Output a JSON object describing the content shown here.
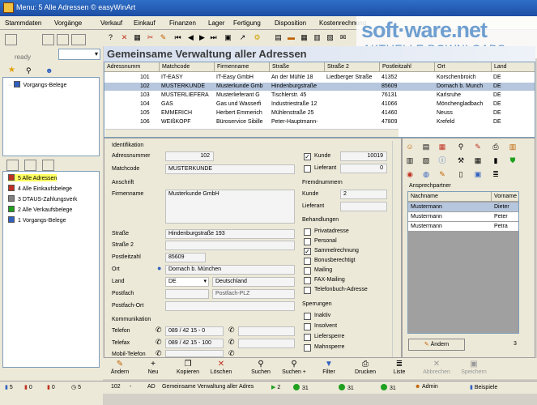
{
  "window": {
    "title": "Menu: 5  Alle Adressen  © easyWinArt"
  },
  "menu": [
    "Stammdaten",
    "Vorgänge",
    "Verkauf",
    "Einkauf",
    "Finanzen",
    "Lager",
    "Fertigung",
    "Disposition",
    "Kostenrechnung",
    "OEM",
    "Fenster"
  ],
  "watermark": {
    "line1": "soft·ware.net",
    "line2": "AKTUELLE DOWNLOADS"
  },
  "left": {
    "status": "ready",
    "tree_top": [
      "Vorgangs-Belege"
    ],
    "tree_bottom": [
      {
        "label": "5  Alle Adressen",
        "color": "#c03020"
      },
      {
        "label": "4  Alle Einkaufsbelege",
        "color": "#c03020"
      },
      {
        "label": "3  DTAUS-Zahlungsverk",
        "color": "#808080"
      },
      {
        "label": "2  Alle Verkaufsbelege",
        "color": "#20a020"
      },
      {
        "label": "1  Vorgangs-Belege",
        "color": "#3060c0"
      }
    ]
  },
  "page_title": "Gemeinsame Verwaltung aller Adressen",
  "grid": {
    "columns": [
      "Adressnumm",
      "Matchcode",
      "Firmenname",
      "Straße",
      "Straße 2",
      "Postleitzahl",
      "Ort",
      "Land"
    ],
    "rows": [
      [
        "101",
        "IT-EASY",
        "IT-Easy GmbH",
        "An der Mühle 18",
        "Liedberger Straße",
        "41352",
        "Korschenbroich",
        "DE"
      ],
      [
        "102",
        "MUSTERKUNDE",
        "Musterkunde Gmb",
        "Hindenburgstraße",
        "",
        "85609",
        "Dornach b. Munch",
        "DE"
      ],
      [
        "103",
        "MUSTERLIEFERA",
        "Musterlieferant G",
        "Tischlerstr. 45",
        "",
        "76131",
        "Karlsruhe",
        "DE"
      ],
      [
        "104",
        "GAS",
        "Gas und Wasserfi",
        "Industriestraße 12",
        "",
        "41066",
        "Mönchengladbach",
        "DE"
      ],
      [
        "105",
        "EMMERICH",
        "Herbert Emmerich",
        "Mühlenstraße 25",
        "",
        "41460",
        "Neuss",
        "DE"
      ],
      [
        "106",
        "WEIßKOPF",
        "Büroservice Sibille",
        "Peter-Hauptmann-",
        "",
        "47809",
        "Krefeld",
        "DE"
      ]
    ]
  },
  "form": {
    "identifikation": "Identifikation",
    "adressnummer_label": "Adressnummer",
    "adressnummer": "102",
    "matchcode_label": "Matchcode",
    "matchcode": "MUSTERKUNDE",
    "anschrift": "Anschrift",
    "firmenname_label": "Firmenname",
    "firmenname": "Musterkunde GmbH",
    "strasse_label": "Straße",
    "strasse": "Hindenburgstraße 193",
    "strasse2_label": "Straße 2",
    "plz_label": "Postleitzahl",
    "plz": "85609",
    "ort_label": "Ort",
    "ort": "Dornach b. München",
    "land_label": "Land",
    "land": "DE",
    "land_name": "Deutschland",
    "postfach_label": "Postfach",
    "postfach_plz": "Postfach-PLZ",
    "postfach_ort_label": "Postfach-Ort",
    "kommunikation": "Kommunikation",
    "telefon_label": "Telefon",
    "telefon": "089 / 42 15 - 0",
    "telefax_label": "Telefax",
    "telefax": "089 / 42 15 - 100",
    "mobil_label": "Mobil-Telefon",
    "kunde_label": "Kunde",
    "kunde_nr": "10019",
    "lieferant_label": "Lieferant",
    "lieferant_nr": "0",
    "fremdnummern": "Fremdnummern",
    "fn_kunde_label": "Kunde",
    "fn_kunde": "2",
    "fn_lieferant_label": "Lieferant",
    "behandlungen": "Behandlungen",
    "beh_items": [
      "Privatadresse",
      "Personal",
      "Sammelrechnung",
      "Bonusberechtigt",
      "Mailing",
      "FAX-Mailing",
      "Telefonbuch-Adresse"
    ],
    "beh_checked": [
      false,
      false,
      true,
      false,
      false,
      false,
      false
    ],
    "sperrungen": "Sperrungen",
    "sperr_items": [
      "Inaktiv",
      "Insolvent",
      "Liefersperre",
      "Mahnsperre"
    ]
  },
  "contacts": {
    "title": "Ansprechpartner",
    "columns": [
      "Nachname",
      "Vorname"
    ],
    "rows": [
      [
        "Mustermann",
        "Dieter"
      ],
      [
        "Mustermann",
        "Peter"
      ],
      [
        "Mustermann",
        "Petra"
      ]
    ],
    "aendern": "Ändern",
    "count": "3"
  },
  "bottom_buttons": [
    {
      "label": "Ändern",
      "icon": "pencil-icon",
      "glyph": "✎",
      "disabled": false
    },
    {
      "label": "Neu",
      "icon": "new-icon",
      "glyph": "+",
      "disabled": false
    },
    {
      "label": "Kopieren",
      "icon": "copy-icon",
      "glyph": "❐",
      "disabled": false
    },
    {
      "label": "Löschen",
      "icon": "delete-icon",
      "glyph": "✕",
      "disabled": false
    },
    {
      "label": "Suchen",
      "icon": "search-icon",
      "glyph": "⚲",
      "disabled": false
    },
    {
      "label": "Suchen +",
      "icon": "search-plus-icon",
      "glyph": "⚲",
      "disabled": false
    },
    {
      "label": "Filter",
      "icon": "filter-icon",
      "glyph": "▼",
      "disabled": false
    },
    {
      "label": "Drucken",
      "icon": "print-icon",
      "glyph": "⎙",
      "disabled": false
    },
    {
      "label": "Liste",
      "icon": "list-icon",
      "glyph": "≣",
      "disabled": false
    },
    {
      "label": "Abbrechen",
      "icon": "cancel-icon",
      "glyph": "✕",
      "disabled": true
    },
    {
      "label": "Speichern",
      "icon": "save-icon",
      "glyph": "▣",
      "disabled": true
    }
  ],
  "statusbar": {
    "left_counts": [
      "5",
      "0",
      "0",
      "5"
    ],
    "record": "102",
    "sep": "-",
    "ad": "AD",
    "desc": "Gemeinsame Verwaltung aller Adres",
    "nav": "2",
    "s1": "31",
    "s2": "31",
    "s3": "31",
    "user": "Admin",
    "db": "Beispiele"
  }
}
